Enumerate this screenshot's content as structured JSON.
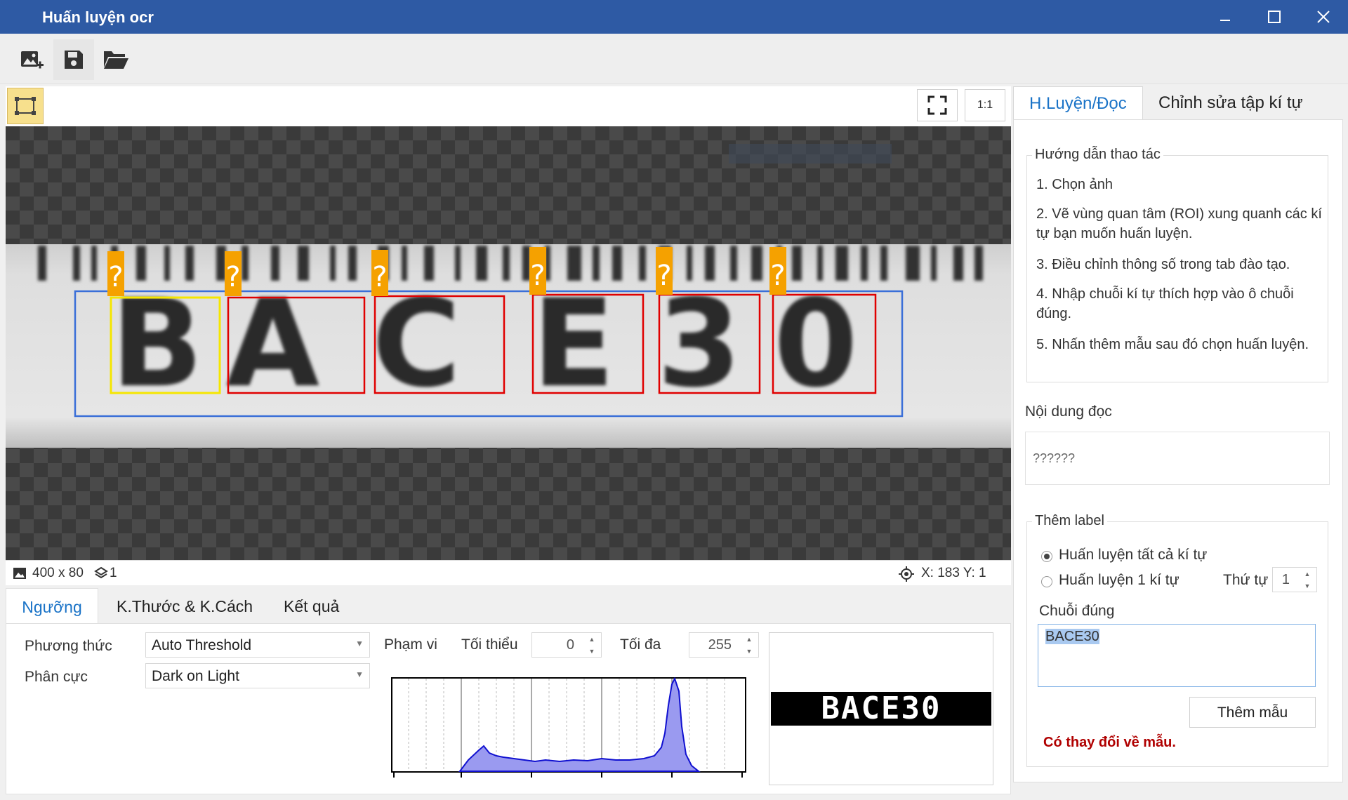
{
  "window": {
    "title": "Huấn luyện ocr"
  },
  "toolbar": {
    "icons": [
      "image-add-icon",
      "save-icon",
      "folder-open-icon"
    ]
  },
  "viewer": {
    "ratio_label": "1:1",
    "image_text": "BACE30",
    "marker": "?",
    "status": {
      "size": "400 x 80",
      "layers": "1",
      "coords": "X: 183 Y: 1"
    }
  },
  "bottom": {
    "tabs": [
      "Ngưỡng",
      "K.Thước & K.Cách",
      "Kết quả"
    ],
    "method_label": "Phương thức",
    "method_value": "Auto Threshold",
    "polarity_label": "Phân cực",
    "polarity_value": "Dark on Light",
    "range_label": "Phạm vi",
    "min_label": "Tối thiểu",
    "min_value": "0",
    "max_label": "Tối đa",
    "max_value": "255",
    "preview_text": "BACE30"
  },
  "right": {
    "tabs": [
      "H.Luyện/Đọc",
      "Chỉnh sửa tập kí tự"
    ],
    "guide_title": "Hướng dẫn thao tác",
    "steps": [
      "1. Chọn ảnh",
      "2. Vẽ vùng quan tâm (ROI) xung quanh các kí tự bạn muốn huấn luyện.",
      "3. Điều chỉnh thông số trong tab đào tạo.",
      "4. Nhập chuỗi kí tự thích hợp vào ô chuỗi đúng.",
      "5. Nhấn thêm mẫu sau đó chọn huấn luyện."
    ],
    "read_label": "Nội dung đọc",
    "read_value": "??????",
    "label_group": "Thêm label",
    "radio_all": "Huấn luyện tất cả kí tự",
    "radio_one": "Huấn luyện 1 kí tự",
    "order_label": "Thứ tự",
    "order_value": "1",
    "correct_label": "Chuỗi đúng",
    "correct_value": "BACE30",
    "add_button": "Thêm mẫu",
    "changed_msg": "Có thay đổi về mẫu."
  },
  "colors": {
    "titlebar": "#2e5aa4",
    "accent": "#1a73c7",
    "roi": "#3a6fd8",
    "char_box": "#e00000",
    "selected_box": "#f5e600",
    "marker": "#f5a100",
    "warning": "#b00000"
  }
}
